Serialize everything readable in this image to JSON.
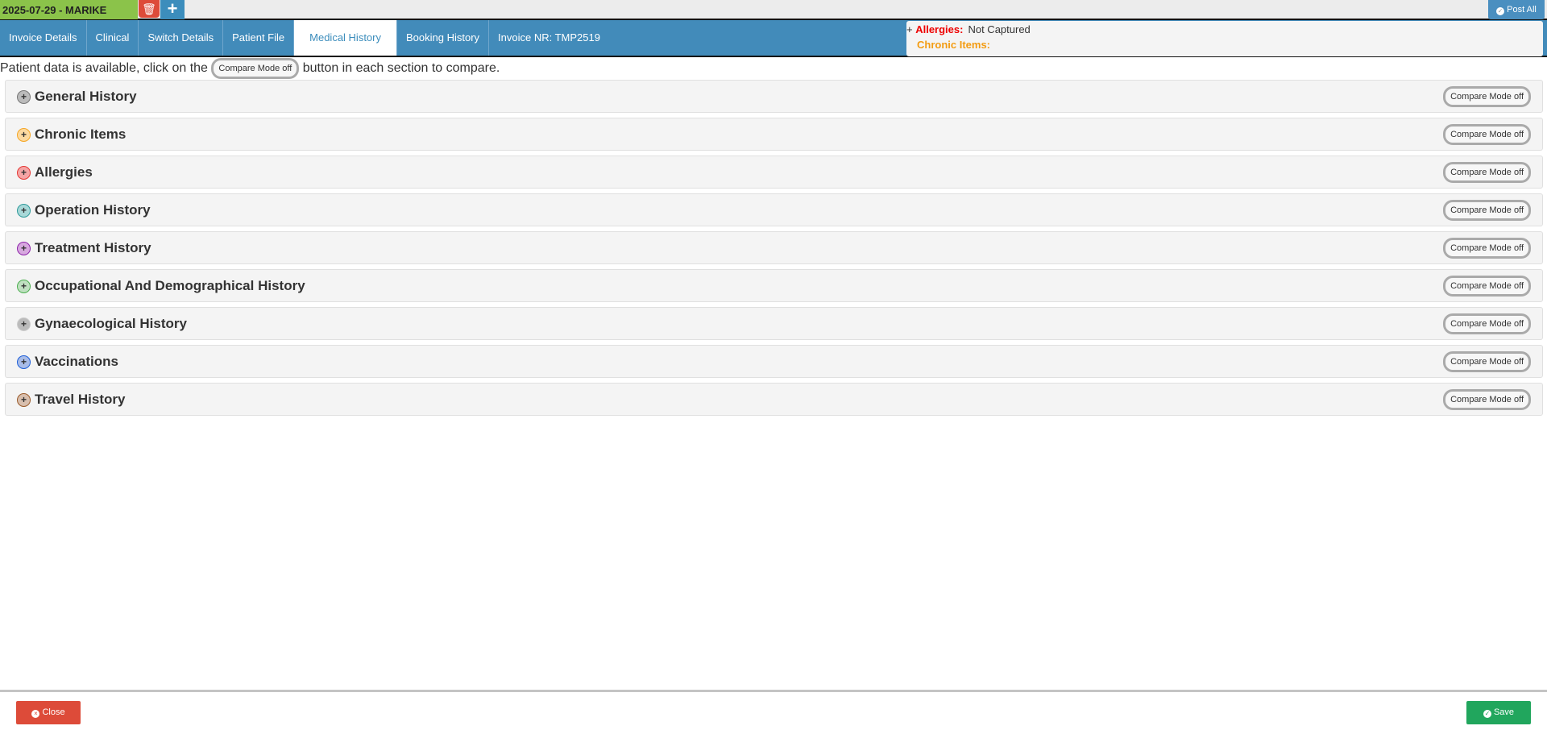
{
  "header": {
    "patient_label": "2025-07-29 - MARIKE",
    "post_all": "Post All"
  },
  "tabs": [
    {
      "label": "Invoice Details"
    },
    {
      "label": "Clinical"
    },
    {
      "label": "Switch Details"
    },
    {
      "label": "Patient File"
    },
    {
      "label": "Medical History",
      "active": true
    },
    {
      "label": "Booking History"
    },
    {
      "label": "Invoice NR: TMP2519"
    }
  ],
  "alerts": {
    "plus": "+",
    "allergies_label": "Allergies:",
    "allergies_value": "Not Captured",
    "chronic_label": "Chronic Items:"
  },
  "note": {
    "before": "Patient data is available, click on the",
    "button": "Compare Mode off",
    "after": "button in each section to compare."
  },
  "sections": [
    {
      "title": "General History",
      "color": "#777777",
      "fill": "#bbbbbb",
      "compare": "Compare Mode off"
    },
    {
      "title": "Chronic Items",
      "color": "#f5a623",
      "fill": "#fcd9a0",
      "compare": "Compare Mode off"
    },
    {
      "title": "Allergies",
      "color": "#e53935",
      "fill": "#f5a5a5",
      "compare": "Compare Mode off"
    },
    {
      "title": "Operation History",
      "color": "#2e9a9a",
      "fill": "#a8d8d8",
      "compare": "Compare Mode off"
    },
    {
      "title": "Treatment History",
      "color": "#8e24aa",
      "fill": "#d7a8df",
      "compare": "Compare Mode off"
    },
    {
      "title": "Occupational And Demographical History",
      "color": "#4caf50",
      "fill": "#bfe0c0",
      "compare": "Compare Mode off"
    },
    {
      "title": "Gynaecological History",
      "color": "#cccccc",
      "fill": "#bbbbbb",
      "compare": "Compare Mode off"
    },
    {
      "title": "Vaccinations",
      "color": "#1e5fd8",
      "fill": "#a8bce8",
      "compare": "Compare Mode off"
    },
    {
      "title": "Travel History",
      "color": "#9a5a2a",
      "fill": "#d8bfae",
      "compare": "Compare Mode off"
    }
  ],
  "footer": {
    "close": "Close",
    "save": "Save"
  }
}
